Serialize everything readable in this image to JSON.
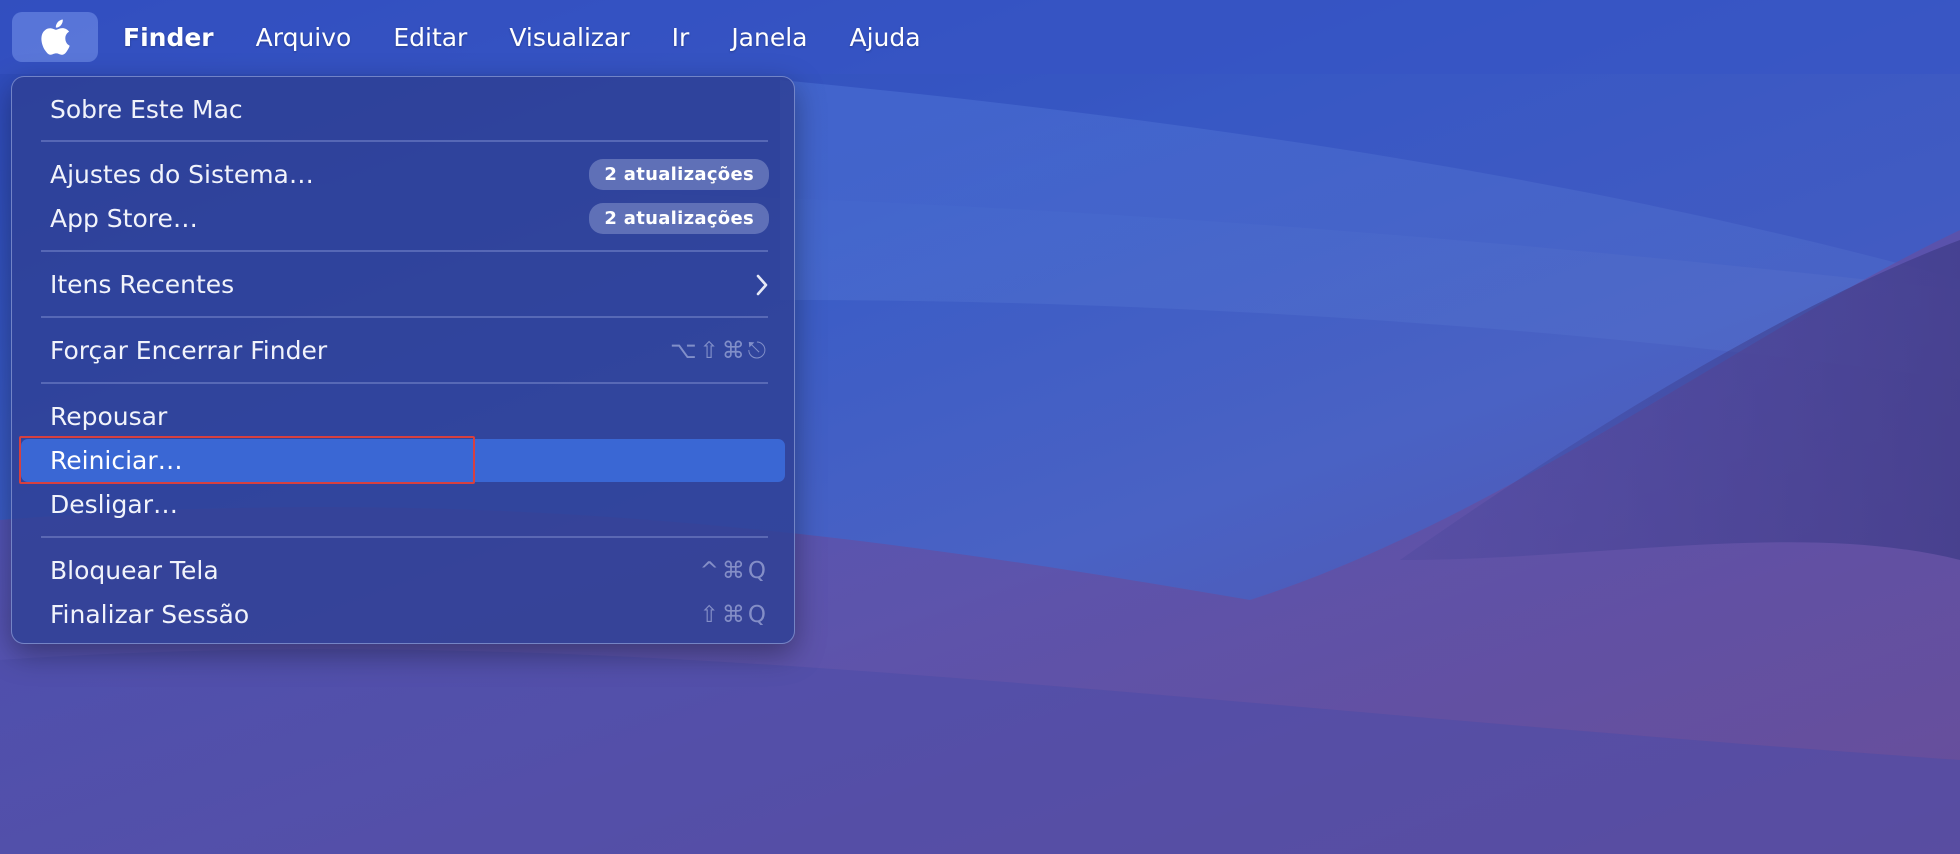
{
  "menubar": {
    "apple_icon": "apple-logo-icon",
    "items": [
      "Finder",
      "Arquivo",
      "Editar",
      "Visualizar",
      "Ir",
      "Janela",
      "Ajuda"
    ]
  },
  "apple_menu": {
    "about": "Sobre Este Mac",
    "system_settings": "Ajustes do Sistema…",
    "system_settings_badge": "2 atualizações",
    "app_store": "App Store…",
    "app_store_badge": "2 atualizações",
    "recent_items": "Itens Recentes",
    "recent_items_icon": "chevron-right-icon",
    "force_quit": "Forçar Encerrar Finder",
    "force_quit_shortcut": "⌥⇧⌘⎋",
    "sleep": "Repousar",
    "restart": "Reiniciar…",
    "shutdown": "Desligar…",
    "lock_screen": "Bloquear Tela",
    "lock_screen_shortcut": "^⌘Q",
    "log_out": "Finalizar Sessão",
    "log_out_shortcut": "⇧⌘Q"
  },
  "colors": {
    "highlight": "#3a67d4",
    "menu_background": "#2e4094",
    "focus_outline": "#d64040"
  }
}
